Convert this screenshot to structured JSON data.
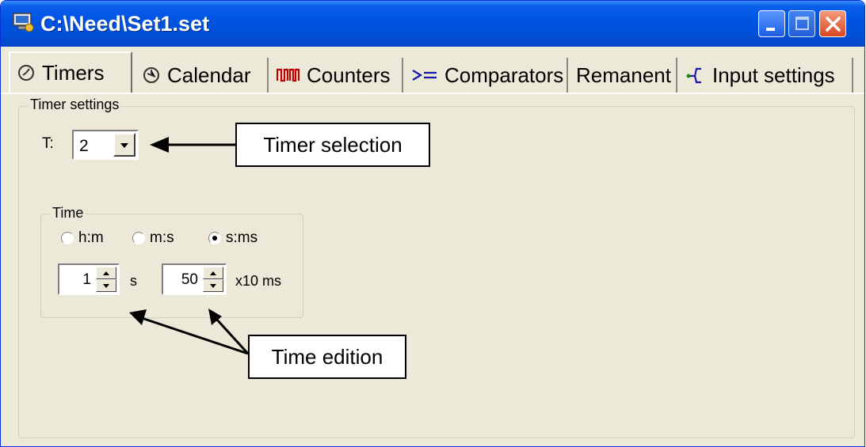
{
  "window": {
    "title": "C:\\Need\\Set1.set"
  },
  "tabs": [
    {
      "label": "Timers",
      "icon": "stopwatch-icon",
      "active": true
    },
    {
      "label": "Calendar",
      "icon": "clock-icon",
      "active": false
    },
    {
      "label": "Counters",
      "icon": "pulse-counter-icon",
      "active": false
    },
    {
      "label": "Comparators",
      "icon": "comparator-icon",
      "active": false
    },
    {
      "label": "Remanent",
      "icon": "",
      "active": false
    },
    {
      "label": "Input settings",
      "icon": "input-branch-icon",
      "active": false
    }
  ],
  "timer_settings": {
    "legend": "Timer settings",
    "t_label": "T:",
    "t_value": "2"
  },
  "time": {
    "legend": "Time",
    "radios": [
      {
        "label": "h:m",
        "checked": false
      },
      {
        "label": "m:s",
        "checked": false
      },
      {
        "label": "s:ms",
        "checked": true
      }
    ],
    "seconds_value": "1",
    "seconds_unit": "s",
    "ms_value": "50",
    "ms_unit": "x10 ms"
  },
  "annotations": {
    "timer_selection": "Timer selection",
    "time_edition": "Time edition"
  },
  "colors": {
    "titlebar": "#0054e3",
    "face": "#ece9d8",
    "close_button": "#d9451f",
    "tab_icon_red": "#c00000",
    "tab_icon_blue": "#1a1aa8"
  }
}
